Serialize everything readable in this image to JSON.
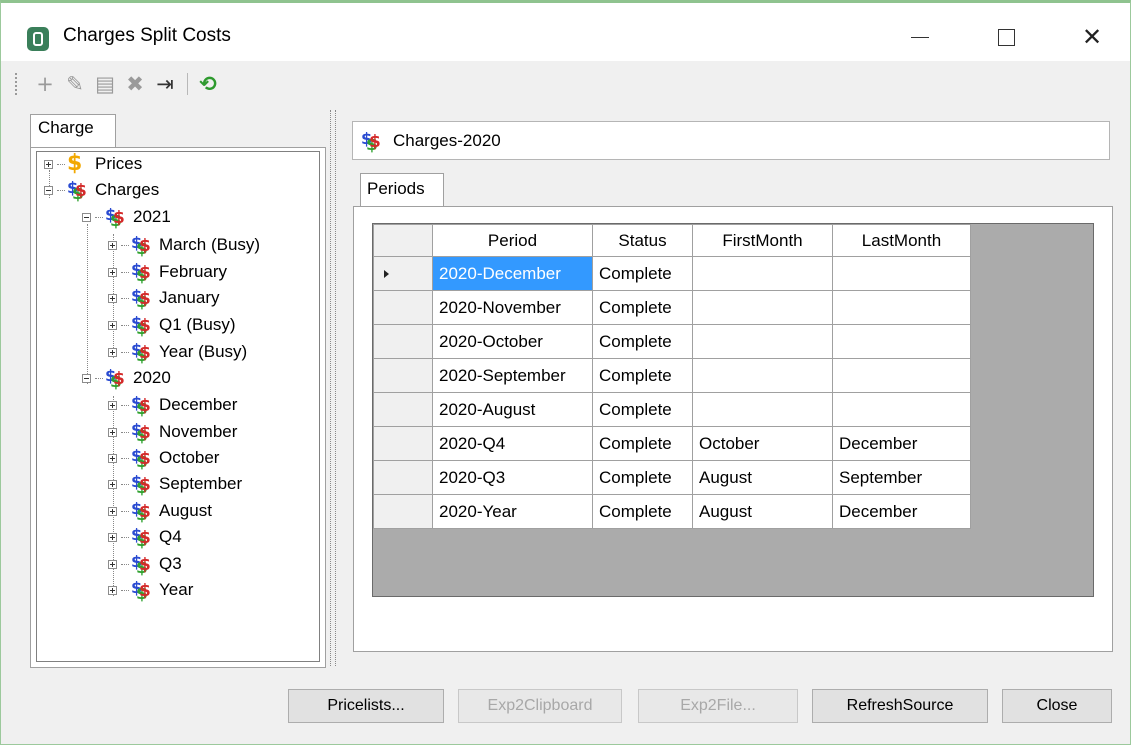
{
  "window": {
    "title": "Charges Split Costs",
    "close_glyph": "✕"
  },
  "toolbar": {
    "items": [
      {
        "name": "add-icon",
        "glyph": "+"
      },
      {
        "name": "edit-icon",
        "glyph": "✎"
      },
      {
        "name": "save-icon",
        "glyph": "▤"
      },
      {
        "name": "delete-icon",
        "glyph": "✖"
      },
      {
        "name": "export-icon",
        "glyph": "⇥"
      },
      {
        "name": "refresh-icon",
        "glyph": "⟲"
      }
    ]
  },
  "left_panel": {
    "tab_label": "Charge",
    "tree": {
      "prices": "Prices",
      "charges": "Charges",
      "year_2021": "2021",
      "year_2021_items": [
        "March (Busy)",
        "February",
        "January",
        "Q1 (Busy)",
        "Year (Busy)"
      ],
      "year_2020": "2020",
      "year_2020_items": [
        "December",
        "November",
        "October",
        "September",
        "August",
        "Q4",
        "Q3",
        "Year"
      ]
    }
  },
  "right_panel": {
    "name": "Charges-2020",
    "tab_label": "Periods",
    "grid": {
      "columns": [
        "Period",
        "Status",
        "FirstMonth",
        "LastMonth"
      ],
      "rows": [
        [
          "2020-December",
          "Complete",
          "",
          ""
        ],
        [
          "2020-November",
          "Complete",
          "",
          ""
        ],
        [
          "2020-October",
          "Complete",
          "",
          ""
        ],
        [
          "2020-September",
          "Complete",
          "",
          ""
        ],
        [
          "2020-August",
          "Complete",
          "",
          ""
        ],
        [
          "2020-Q4",
          "Complete",
          "October",
          "December"
        ],
        [
          "2020-Q3",
          "Complete",
          "August",
          "September"
        ],
        [
          "2020-Year",
          "Complete",
          "August",
          "December"
        ]
      ]
    }
  },
  "buttons": {
    "pricelists": "Pricelists...",
    "exp2clipboard": "Exp2Clipboard",
    "exp2file": "Exp2File...",
    "refreshsource": "RefreshSource",
    "close": "Close"
  }
}
